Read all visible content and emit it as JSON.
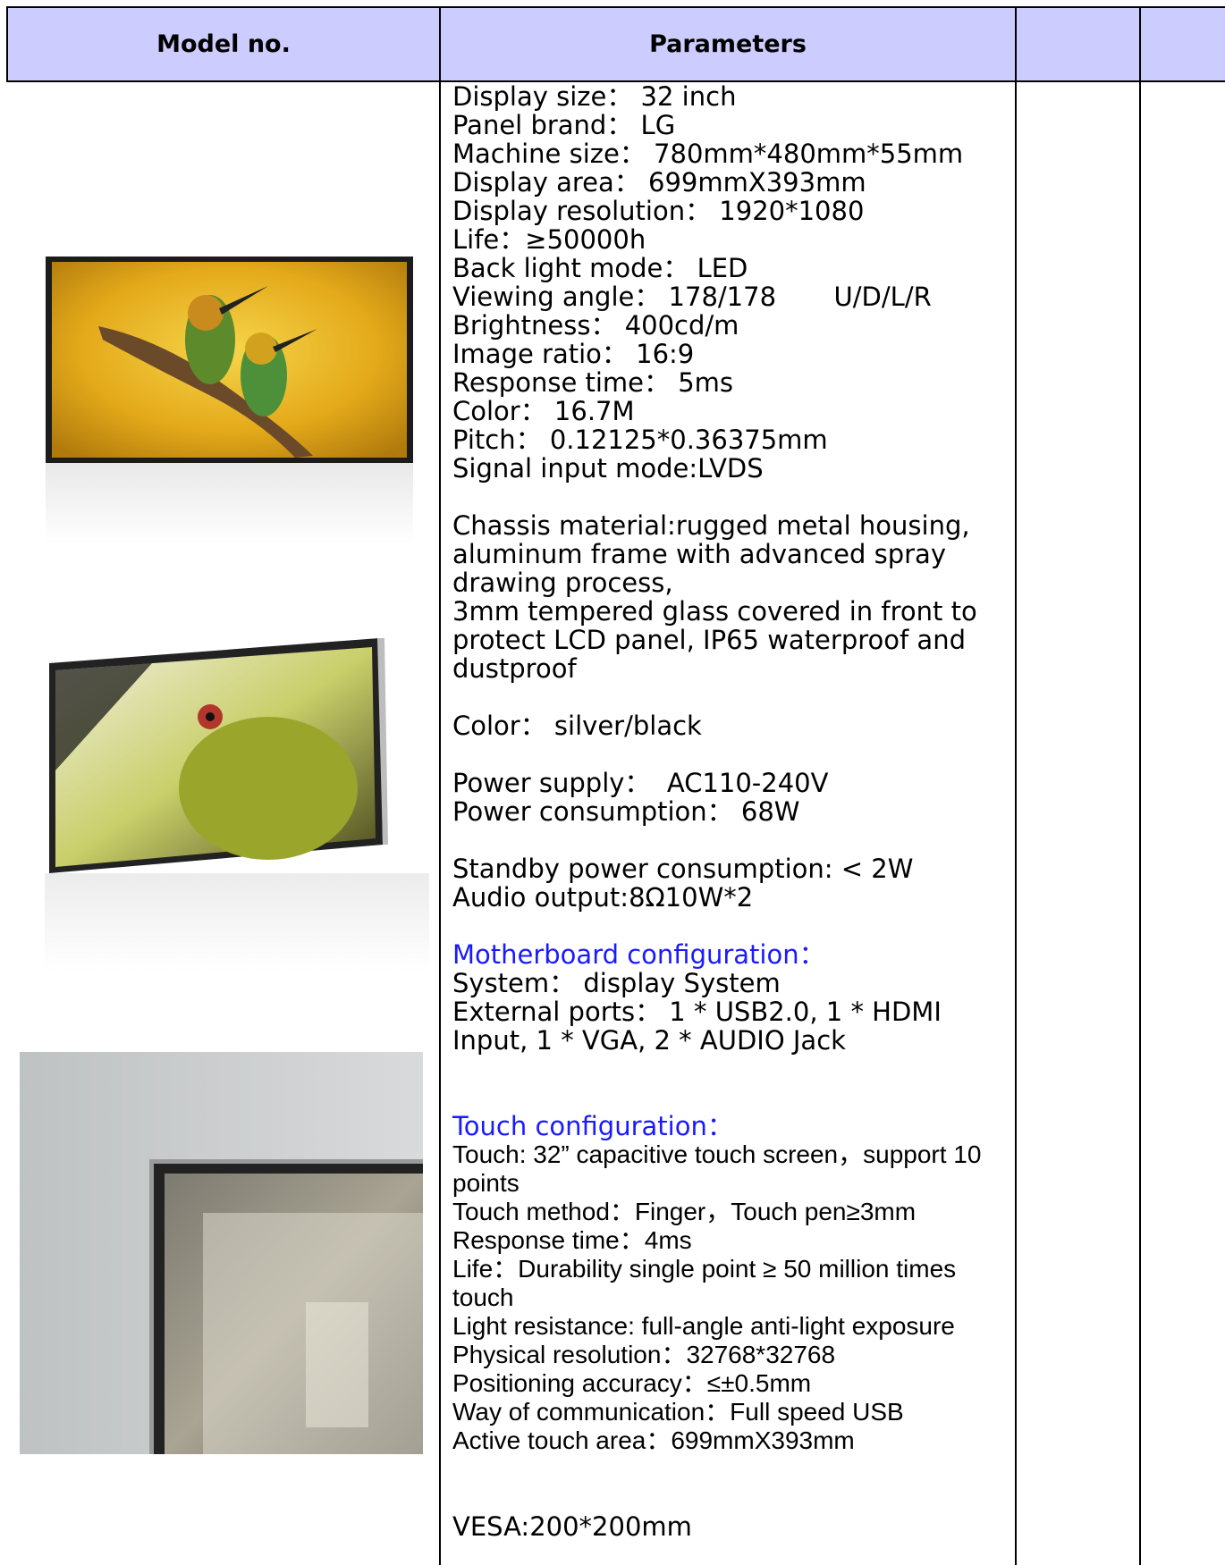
{
  "header": {
    "model_no": "Model no.",
    "parameters": "Parameters",
    "col3": "",
    "col4": ""
  },
  "images": [
    {
      "icon": "monitor-photo-birds",
      "subject": "two bee-eater birds on a branch, yellow background"
    },
    {
      "icon": "monitor-photo-green-bird",
      "subject": "green bird close-up on angled monitor"
    },
    {
      "icon": "monitor-photo-corner",
      "subject": "close-up corner of silver bezel screen"
    }
  ],
  "params": {
    "display_size": "Display size： 32 inch",
    "panel_brand": "Panel brand： LG",
    "machine_size": "Machine size： 780mm*480mm*55mm",
    "display_area": "Display area： 699mmX393mm",
    "display_resolution": "Display resolution： 1920*1080",
    "life": "Life：≥50000h",
    "back_light": "Back light mode： LED",
    "viewing_angle": "Viewing angle： 178/178       U/D/L/R",
    "brightness": "Brightness： 400cd/m",
    "image_ratio": "Image ratio： 16:9",
    "response_time": "Response time： 5ms",
    "color_depth": "Color： 16.7M",
    "pitch": "Pitch： 0.12125*0.36375mm",
    "signal_input": "Signal input mode:LVDS",
    "chassis": "Chassis material:rugged metal housing, aluminum frame with advanced spray drawing process,",
    "glass": "3mm tempered glass covered in front to protect LCD panel, IP65 waterproof and dustproof",
    "color_options": "Color： silver/black",
    "power_supply": "Power supply：  AC110-240V",
    "power_consumption": "Power consumption： 68W",
    "standby": "Standby power consumption: < 2W",
    "audio": "Audio output:8Ω10W*2",
    "mb_heading": "Motherboard configuration：",
    "system": "System： display System",
    "ports": "External ports：  1 * USB2.0, 1 * HDMI Input, 1 * VGA, 2 * AUDIO Jack",
    "touch_heading": "Touch configuration：",
    "touch": "Touch: 32” capacitive touch screen，support 10 points",
    "touch_method": "Touch method：Finger，Touch pen≥3mm",
    "touch_response": "Response time：4ms",
    "touch_life": "Life：Durability single point ≥ 50 million times touch",
    "light_resistance": "Light resistance: full-angle anti-light exposure",
    "physical_resolution": "Physical resolution：32768*32768",
    "positioning": "Positioning accuracy：≤±0.5mm",
    "communication": "Way of communication：Full speed USB",
    "active_area": "Active touch area：699mmX393mm",
    "vesa": "VESA:200*200mm"
  },
  "colors": {
    "header_bg": "#ccccff",
    "heading_blue": "#1a1aff",
    "border": "#000000"
  }
}
